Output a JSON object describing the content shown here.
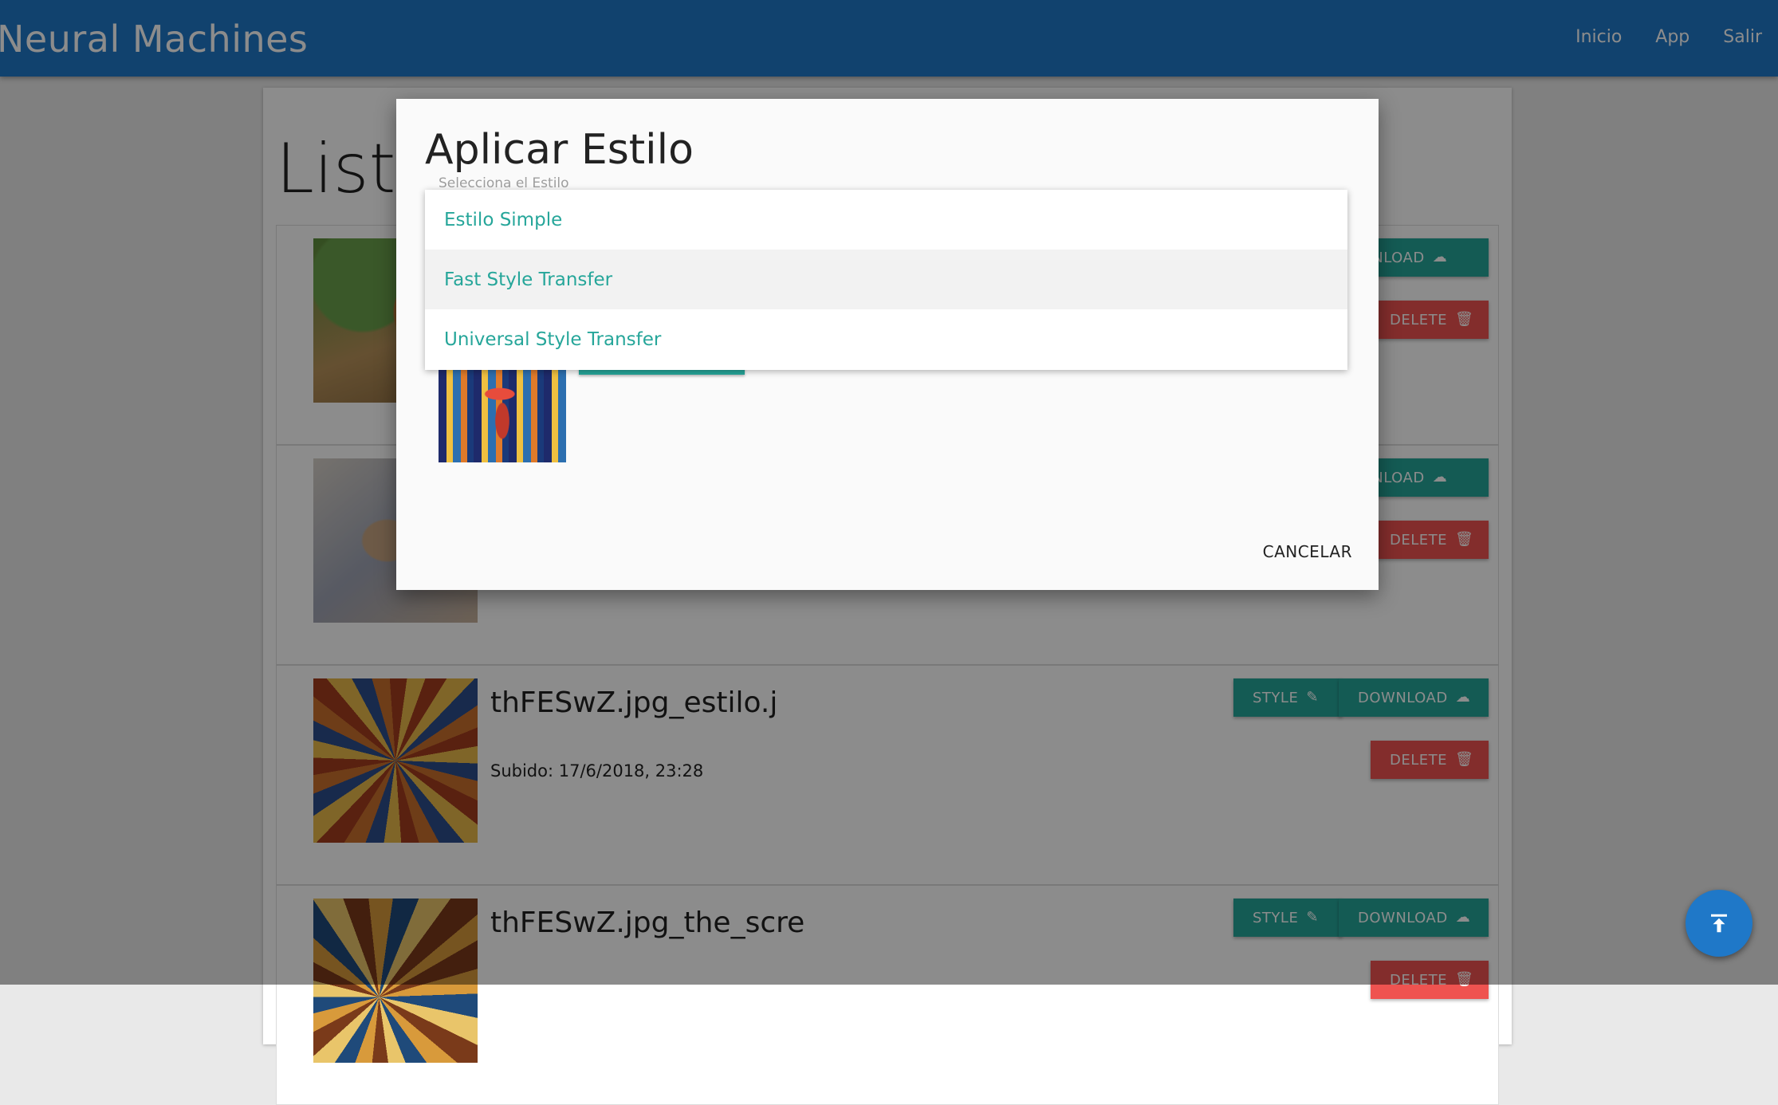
{
  "navbar": {
    "brand": "Neural Machines",
    "links": [
      "Inicio",
      "App",
      "Salir"
    ]
  },
  "main": {
    "title": "Lista",
    "items": [
      {
        "name": "",
        "date": ""
      },
      {
        "name": "",
        "date": ""
      },
      {
        "name": "thFESwZ.jpg_estilo.j",
        "date": "Subido: 17/6/2018, 23:28"
      },
      {
        "name": "thFESwZ.jpg_the_scre",
        "date": ""
      }
    ],
    "buttons": {
      "style": "STYLE",
      "download": "DOWNLOAD",
      "download_partial": "WNLOAD",
      "delete": "DELETE",
      "delete_partial": "DELETE"
    }
  },
  "modal": {
    "title": "Aplicar Estilo",
    "select_label": "Selecciona el Estilo",
    "options": [
      "Estilo Simple",
      "Fast Style Transfer",
      "Universal Style Transfer"
    ],
    "cancel": "CANCELAR"
  },
  "icons": {
    "download": "cloud-download-icon",
    "delete": "trash-icon",
    "style": "brush-icon",
    "fab": "vertical-align-top-icon"
  },
  "colors": {
    "navbar": "#1f78c8",
    "teal": "#26a69a",
    "red": "#ef5350",
    "overlay": "rgba(0,0,0,0.45)"
  }
}
